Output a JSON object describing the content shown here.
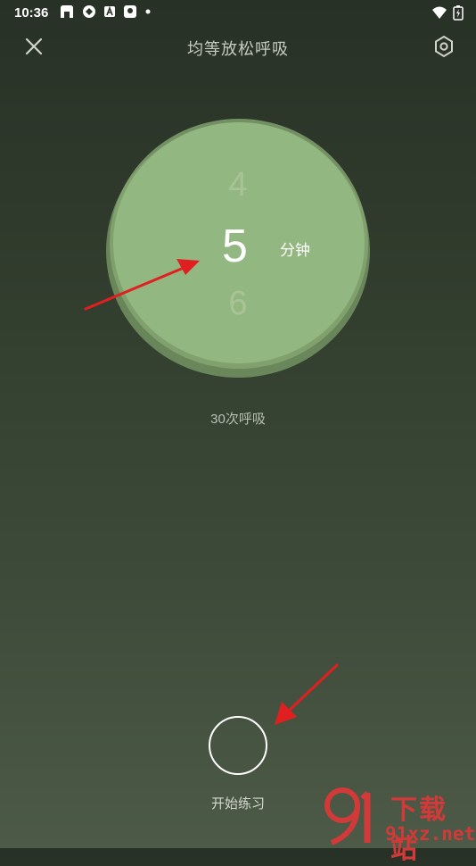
{
  "status_bar": {
    "time": "10:36",
    "left_icons": [
      "notification-app-icon",
      "sync-icon",
      "a-badge-icon",
      "map-pin-icon",
      "dot-icon"
    ],
    "right_icons": [
      "wifi-icon",
      "battery-icon"
    ]
  },
  "header": {
    "title": "均等放松呼吸",
    "close_icon": "close-icon",
    "settings_icon": "settings-hex-icon"
  },
  "picker": {
    "previous": "4",
    "current": "5",
    "next": "6",
    "unit": "分钟",
    "colors": {
      "dial_main": "#93b780",
      "dial_ring": "#7c9d69"
    }
  },
  "breath_count": "30次呼吸",
  "start": {
    "label": "开始练习"
  },
  "watermark": {
    "brand": "下载站",
    "domain": "91xz.net",
    "logo_text": "91"
  },
  "annotation_color": "#e02020"
}
